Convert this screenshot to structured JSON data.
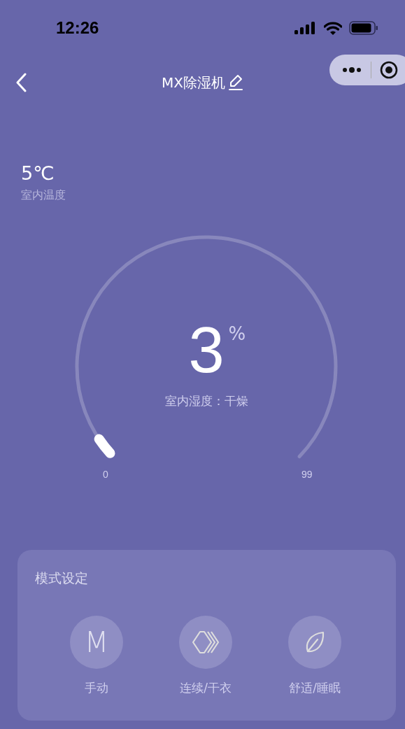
{
  "status_bar": {
    "time": "12:26"
  },
  "nav": {
    "title": "MX除湿机"
  },
  "temperature": {
    "value": "5℃",
    "label": "室内温度"
  },
  "gauge": {
    "value": "3",
    "unit": "%",
    "status": "室内湿度：干燥",
    "min_label": "0",
    "max_label": "99"
  },
  "modes": {
    "title": "模式设定",
    "items": [
      {
        "kind": "letter",
        "glyph": "M",
        "label": "手动"
      },
      {
        "kind": "layers",
        "label": "连续/干衣"
      },
      {
        "kind": "leaf",
        "label": "舒适/睡眠"
      }
    ]
  }
}
